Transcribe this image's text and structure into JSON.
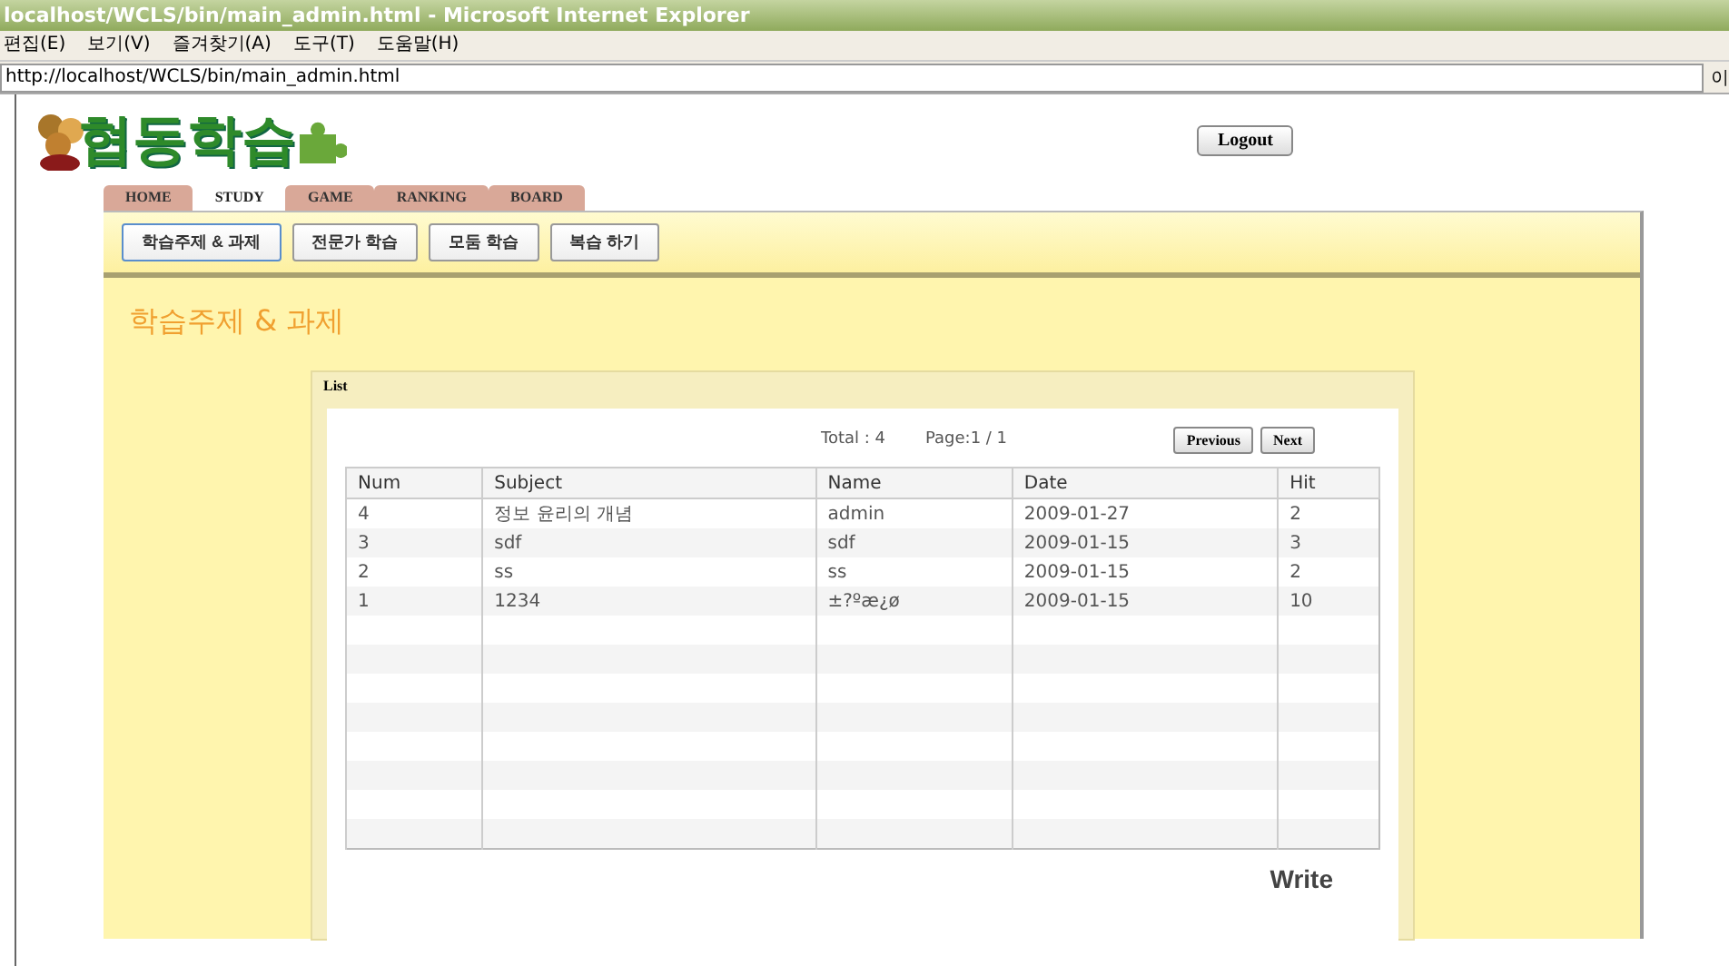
{
  "window": {
    "title": "localhost/WCLS/bin/main_admin.html - Microsoft Internet Explorer"
  },
  "menu": [
    "편집(E)",
    "보기(V)",
    "즐겨찾기(A)",
    "도구(T)",
    "도움말(H)"
  ],
  "address_bar": {
    "value": "http://localhost/WCLS/bin/main_admin.html",
    "go_label": "이"
  },
  "logo": {
    "text": "협동학습"
  },
  "logout_button": "Logout",
  "tabs": [
    {
      "label": "HOME",
      "selected": false
    },
    {
      "label": "STUDY",
      "selected": true
    },
    {
      "label": "GAME",
      "selected": false
    },
    {
      "label": "RANKING",
      "selected": false
    },
    {
      "label": "BOARD",
      "selected": false
    }
  ],
  "subtabs": [
    {
      "label": "학습주제 & 과제",
      "selected": true
    },
    {
      "label": "전문가 학습",
      "selected": false
    },
    {
      "label": "모둠 학습",
      "selected": false
    },
    {
      "label": "복습 하기",
      "selected": false
    }
  ],
  "heading": "학습주제 & 과제",
  "list": {
    "title": "List",
    "total": "Total : 4",
    "page": "Page:1 / 1",
    "buttons": [
      "Previous",
      "Next"
    ],
    "columns": [
      "Num",
      "Subject",
      "Name",
      "Date",
      "Hit"
    ],
    "rows": [
      [
        "4",
        "정보 윤리의 개념",
        "admin",
        "2009-01-27",
        "2"
      ],
      [
        "3",
        "sdf",
        "sdf",
        "2009-01-15",
        "3"
      ],
      [
        "2",
        "ss",
        "ss",
        "2009-01-15",
        "2"
      ],
      [
        "1",
        "1234",
        "±?ºæ¿ø",
        "2009-01-15",
        "10"
      ]
    ],
    "write_button": "Write"
  }
}
